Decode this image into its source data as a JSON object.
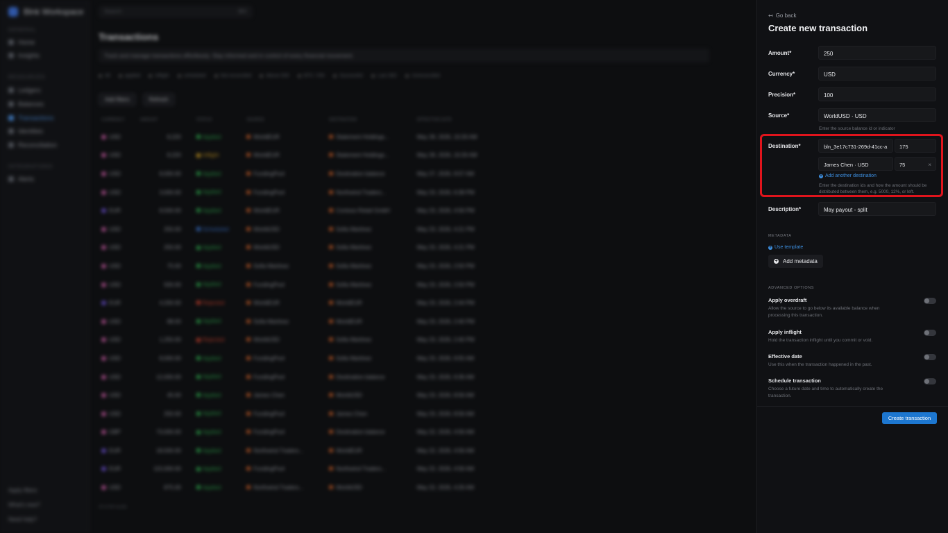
{
  "background": {
    "workspace": "Blnk Workspace",
    "search_placeholder": "Search",
    "search_shortcut": "⌘K",
    "sidebar": {
      "groups": [
        {
          "label": "GENERAL",
          "items": [
            "Home",
            "Insights"
          ]
        },
        {
          "label": "RESOURCES",
          "items": [
            "Ledgers",
            "Balances",
            "Transactions",
            "Identities",
            "Reconciliation"
          ]
        },
        {
          "label": "INTEGRATIONS",
          "items": [
            "Alerts"
          ]
        }
      ],
      "active_item": "Transactions",
      "bottom": [
        "Apply filters",
        "What's new?",
        "Need help?"
      ]
    },
    "page_title": "Transactions",
    "page_subtitle": "Track and manage transactions effortlessly. Stay informed and in control of every financial movement.",
    "filters": [
      "All",
      "applied",
      "inflight",
      "scheduled",
      "Not reconciled",
      "Above 500",
      "BTC / Eth",
      "Successful",
      "Last 30D",
      "Unreconciled"
    ],
    "actions": [
      "Add filters",
      "Refresh"
    ],
    "table": {
      "columns": [
        "CURRENCY",
        "AMOUNT",
        "STATUS",
        "SOURCE",
        "DESTINATION",
        "EFFECTIVE DATE"
      ],
      "rows": [
        [
          "USD",
          "8,220",
          "Applied",
          "WorldEUR",
          "Statement Holdings...",
          "May 28, 2026, 10:26 AM"
        ],
        [
          "USD",
          "8,220",
          "Inflight",
          "WorldEUR",
          "Statement Holdings...",
          "May 28, 2026, 10:26 AM"
        ],
        [
          "USD",
          "8,000.00",
          "Applied",
          "FundingPool",
          "Destination balance",
          "May 27, 2026, 9:57 AM"
        ],
        [
          "USD",
          "3,000.00",
          "Applied",
          "FundingPool",
          "Northwind Traders...",
          "May 23, 2026, 6:38 PM"
        ],
        [
          "EUR",
          "8,500.00",
          "Applied",
          "WorldEUR",
          "Contoso Retail GmbH",
          "May 23, 2026, 4:56 PM"
        ],
        [
          "USD",
          "250.00",
          "Scheduled",
          "WorldUSD",
          "Sofia Martinez",
          "May 23, 2026, 4:21 PM"
        ],
        [
          "USD",
          "250.00",
          "Applied",
          "WorldUSD",
          "Sofia Martinez",
          "May 23, 2026, 4:21 PM"
        ],
        [
          "USD",
          "75.00",
          "Applied",
          "Sofia Martinez",
          "Sofia Martinez",
          "May 23, 2026, 2:50 PM"
        ],
        [
          "USD",
          "500.00",
          "Applied",
          "FundingPool",
          "Sofia Martinez",
          "May 23, 2026, 2:50 PM"
        ],
        [
          "EUR",
          "4,200.00",
          "Rejected",
          "WorldEUR",
          "WorldEUR",
          "May 23, 2026, 2:44 PM"
        ],
        [
          "USD",
          "88.00",
          "Applied",
          "Sofia Martinez",
          "WorldEUR",
          "May 23, 2026, 2:40 PM"
        ],
        [
          "USD",
          "1,250.00",
          "Rejected",
          "WorldUSD",
          "Sofia Martinez",
          "May 23, 2026, 2:40 PM"
        ],
        [
          "USD",
          "8,000.00",
          "Applied",
          "FundingPool",
          "Sofia Martinez",
          "May 23, 2026, 9:55 AM"
        ],
        [
          "USD",
          "12,000.00",
          "Applied",
          "FundingPool",
          "Destination balance",
          "May 23, 2026, 9:36 AM"
        ],
        [
          "USD",
          "45.00",
          "Applied",
          "James Chen",
          "WorldUSD",
          "May 23, 2026, 8:56 AM"
        ],
        [
          "USD",
          "250.00",
          "Applied",
          "FundingPool",
          "James Chen",
          "May 23, 2026, 8:56 AM"
        ],
        [
          "GBP",
          "73,000.00",
          "Applied",
          "FundingPool",
          "Destination balance",
          "May 22, 2026, 4:56 AM"
        ],
        [
          "EUR",
          "18,500.00",
          "Applied",
          "Northwind Traders...",
          "WorldEUR",
          "May 22, 2026, 4:56 AM"
        ],
        [
          "EUR",
          "115,000.00",
          "Applied",
          "FundingPool",
          "Northwind Traders...",
          "May 22, 2026, 4:56 AM"
        ],
        [
          "USD",
          "875.00",
          "Applied",
          "Northwind Traders...",
          "WorldUSD",
          "May 22, 2026, 4:26 AM"
        ]
      ],
      "footer": "20 of 48 results"
    }
  },
  "panel": {
    "go_back": "Go back",
    "title": "Create new transaction",
    "amount": {
      "label": "Amount*",
      "value": "250"
    },
    "currency": {
      "label": "Currency*",
      "value": "USD"
    },
    "precision": {
      "label": "Precision*",
      "value": "100"
    },
    "source": {
      "label": "Source*",
      "value": "WorldUSD · USD",
      "hint": "Enter the source balance id or indicator"
    },
    "destination": {
      "label": "Destination*",
      "rows": [
        {
          "id": "bln_3e17c731-269d-41cc-a",
          "amount": "175"
        },
        {
          "id": "James Chen · USD",
          "amount": "75",
          "remove": "×"
        }
      ],
      "add_label": "Add another destination",
      "hint_line1": "Enter the destination ids and how the amount should be",
      "hint_line2": "distributed between them, e.g. 5000, 12%, or left."
    },
    "description": {
      "label": "Description*",
      "value": "May payout - split"
    },
    "metadata_heading": "METADATA",
    "use_template": "Use template",
    "add_metadata": "Add metadata",
    "advanced_heading": "ADVANCED OPTIONS",
    "options": [
      {
        "title": "Apply overdraft",
        "desc": "Allow the source to go below its available balance when processing this transaction.",
        "enabled": false
      },
      {
        "title": "Apply inflight",
        "desc": "Hold the transaction inflight until you commit or void.",
        "enabled": false
      },
      {
        "title": "Effective date",
        "desc": "Use this when the transaction happened in the past.",
        "enabled": false
      },
      {
        "title": "Schedule transaction",
        "desc": "Choose a future date and time to automatically create the transaction.",
        "enabled": false
      }
    ],
    "submit_label": "Create transaction"
  },
  "colors": {
    "accent": "#1d77d0",
    "highlight": "#e0141c"
  }
}
